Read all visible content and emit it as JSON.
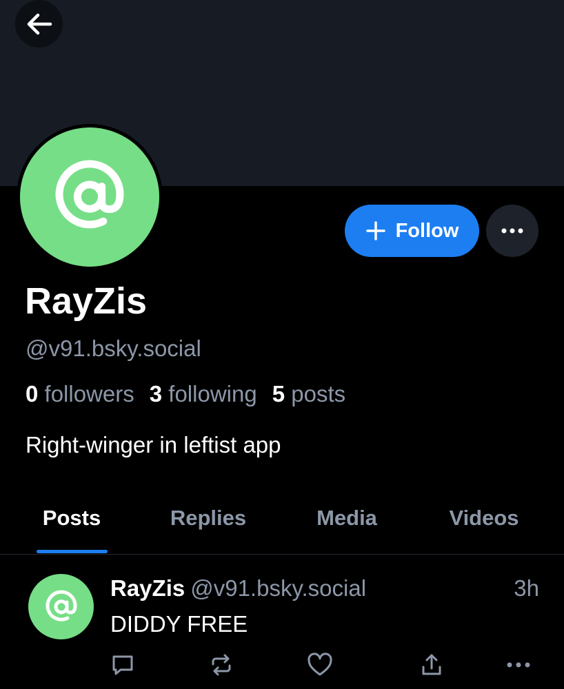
{
  "header": {
    "back_icon": "arrow-left-icon",
    "banner_color": "#161b24"
  },
  "profile": {
    "avatar_icon": "at-sign-icon",
    "avatar_color": "#76de87",
    "display_name": "RayZis",
    "handle": "@v91.bsky.social",
    "bio": "Right-winger in leftist app",
    "stats": {
      "followers_count": "0",
      "followers_label": "followers",
      "following_count": "3",
      "following_label": "following",
      "posts_count": "5",
      "posts_label": "posts"
    }
  },
  "actions": {
    "follow_label": "Follow",
    "follow_icon": "plus-icon",
    "follow_color": "#1d7ef2",
    "more_icon": "ellipsis-icon"
  },
  "tabs": [
    {
      "label": "Posts",
      "active": true
    },
    {
      "label": "Replies",
      "active": false
    },
    {
      "label": "Media",
      "active": false
    },
    {
      "label": "Videos",
      "active": false
    }
  ],
  "feed": {
    "posts": [
      {
        "author": "RayZis",
        "handle": "@v91.bsky.social",
        "time": "3h",
        "text": "DIDDY FREE",
        "action_icons": [
          "reply-icon",
          "repost-icon",
          "like-icon",
          "share-icon",
          "ellipsis-icon"
        ]
      }
    ]
  }
}
